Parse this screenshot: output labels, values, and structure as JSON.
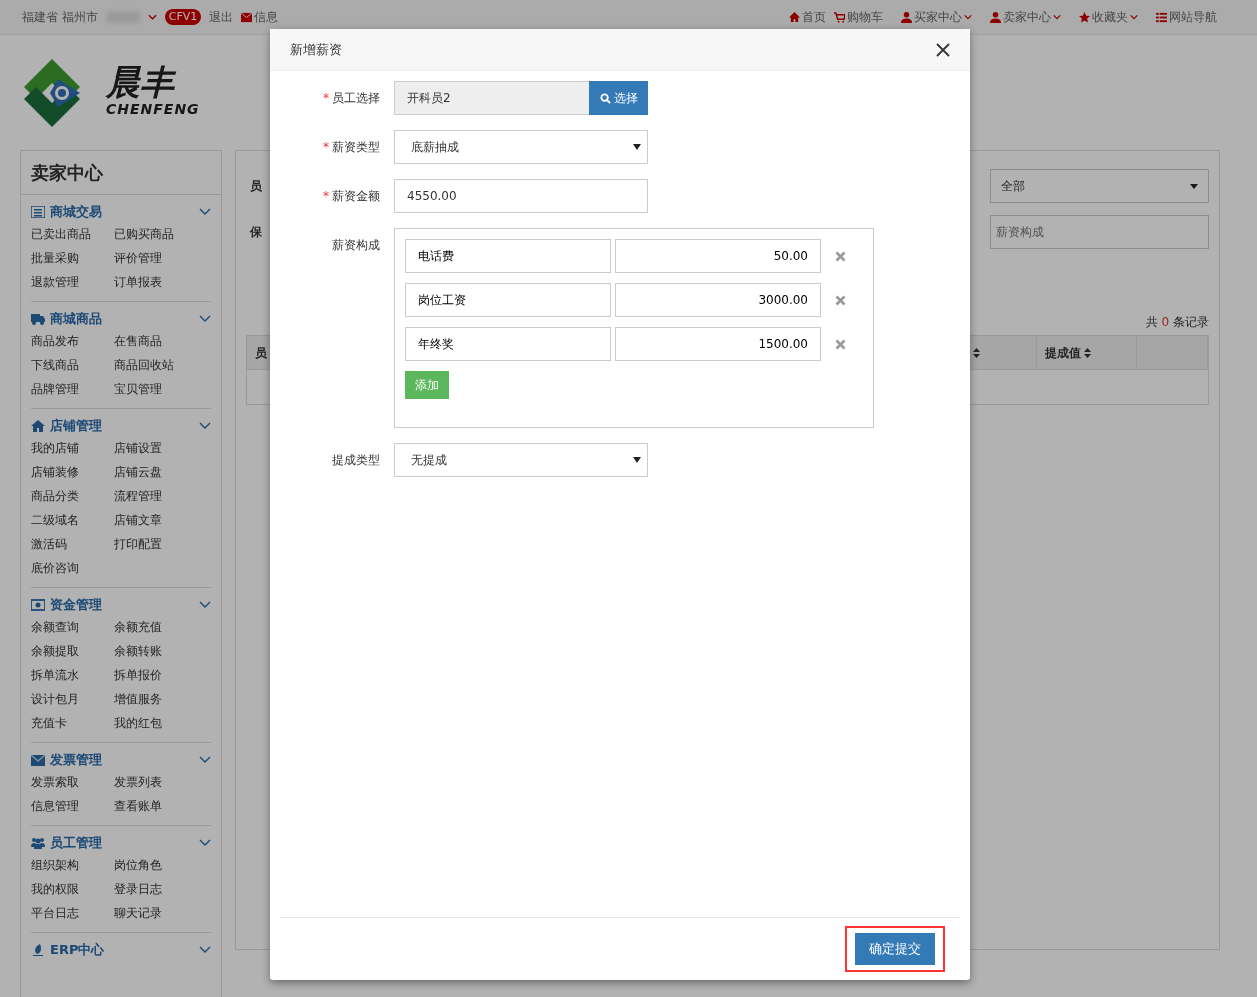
{
  "topbar": {
    "province": "福建省",
    "city": "福州市",
    "badge": "CFV1",
    "logout": "退出",
    "messages": "信息",
    "links": [
      {
        "label": "首页",
        "dropdown": false
      },
      {
        "label": "购物车",
        "dropdown": false
      },
      {
        "label": "买家中心",
        "dropdown": true
      },
      {
        "label": "卖家中心",
        "dropdown": true
      },
      {
        "label": "收藏夹",
        "dropdown": true
      },
      {
        "label": "网站导航",
        "dropdown": false
      }
    ]
  },
  "logo": {
    "name": "晨丰",
    "latin": "CHENFENG"
  },
  "sidebar": {
    "title": "卖家中心",
    "groups": [
      {
        "title": "商城交易",
        "links": [
          "已卖出商品",
          "已购买商品",
          "批量采购",
          "评价管理",
          "退款管理",
          "订单报表"
        ]
      },
      {
        "title": "商城商品",
        "links": [
          "商品发布",
          "在售商品",
          "下线商品",
          "商品回收站",
          "品牌管理",
          "宝贝管理"
        ]
      },
      {
        "title": "店铺管理",
        "links": [
          "我的店铺",
          "店铺设置",
          "店铺装修",
          "店铺云盘",
          "商品分类",
          "流程管理",
          "二级域名",
          "店铺文章",
          "激活码",
          "打印配置",
          "底价咨询"
        ]
      },
      {
        "title": "资金管理",
        "links": [
          "余额查询",
          "余额充值",
          "余额提取",
          "余额转账",
          "拆单流水",
          "拆单报价",
          "设计包月",
          "增值服务",
          "充值卡",
          "我的红包"
        ]
      },
      {
        "title": "发票管理",
        "links": [
          "发票索取",
          "发票列表",
          "信息管理",
          "查看账单"
        ]
      },
      {
        "title": "员工管理",
        "links": [
          "组织架构",
          "岗位角色",
          "我的权限",
          "登录日志",
          "平台日志",
          "聊天记录"
        ]
      },
      {
        "title": "ERP中心"
      }
    ]
  },
  "main": {
    "filter_labels": [
      "员",
      "保"
    ],
    "status_select": "全部",
    "composition_placeholder": "薪资构成",
    "record_count": {
      "prefix": "共",
      "count": "0",
      "suffix": "条记录"
    },
    "table": {
      "columns": [
        {
          "label": "员",
          "sortable": false
        },
        {
          "sortable": true
        },
        {
          "label": "提成值",
          "sortable": true
        }
      ]
    }
  },
  "modal": {
    "title": "新增薪资",
    "fields": [
      {
        "kind": "picker",
        "label": "员工选择",
        "marker": "*",
        "value": "开科员2",
        "button": "选择"
      },
      {
        "kind": "select",
        "label": "薪资类型",
        "marker": "*",
        "value": "底薪抽成"
      },
      {
        "kind": "text",
        "label": "薪资金额",
        "marker": "*",
        "value": "4550.00"
      },
      {
        "kind": "composition",
        "label": "薪资构成",
        "add_button": "添加",
        "items": [
          {
            "name": "电话费",
            "amount": "50.00"
          },
          {
            "name": "岗位工资",
            "amount": "3000.00"
          },
          {
            "name": "年终奖",
            "amount": "1500.00"
          }
        ]
      },
      {
        "kind": "select",
        "label": "提成类型",
        "value": "无提成"
      }
    ],
    "submit": {
      "label": "确定提交",
      "highlighted": true
    }
  }
}
